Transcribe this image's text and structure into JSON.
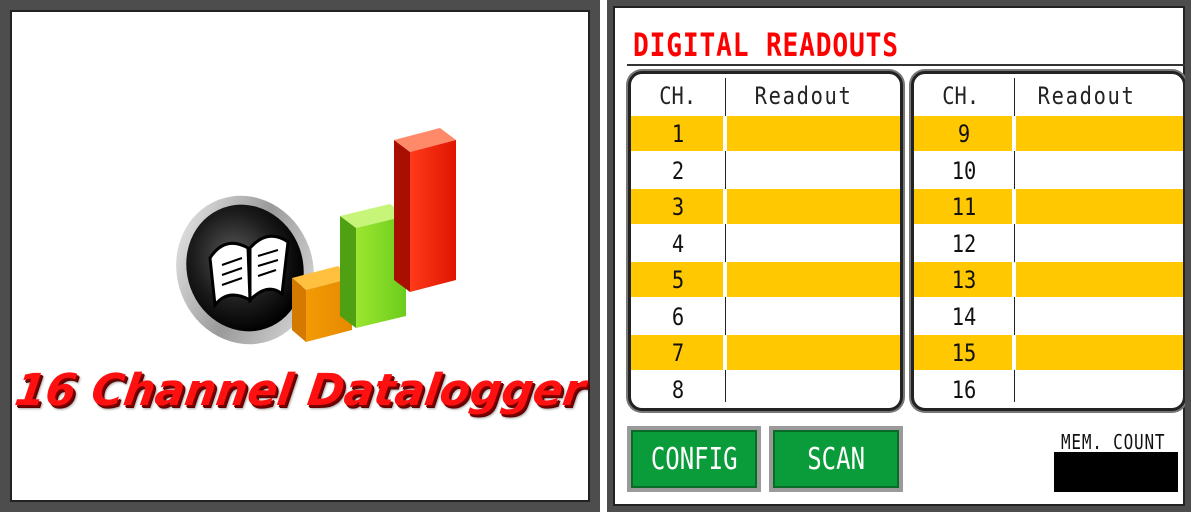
{
  "splash": {
    "title": "16 Channel Datalogger",
    "logo_icon": "datalogger-logo-icon",
    "book_icon": "open-book-icon",
    "bar_chart_icon": "bar-chart-icon",
    "title_color": "#ff1010"
  },
  "readouts": {
    "title": "DIGITAL READOUTS",
    "title_color": "#ff0000",
    "highlight_color": "#ffc800",
    "left_table": {
      "header_ch": "CH.",
      "header_readout": "Readout",
      "rows": [
        {
          "ch": "1",
          "readout": "",
          "highlight": true
        },
        {
          "ch": "2",
          "readout": "",
          "highlight": false
        },
        {
          "ch": "3",
          "readout": "",
          "highlight": true
        },
        {
          "ch": "4",
          "readout": "",
          "highlight": false
        },
        {
          "ch": "5",
          "readout": "",
          "highlight": true
        },
        {
          "ch": "6",
          "readout": "",
          "highlight": false
        },
        {
          "ch": "7",
          "readout": "",
          "highlight": true
        },
        {
          "ch": "8",
          "readout": "",
          "highlight": false
        }
      ]
    },
    "right_table": {
      "header_ch": "CH.",
      "header_readout": "Readout",
      "rows": [
        {
          "ch": "9",
          "readout": "",
          "highlight": true
        },
        {
          "ch": "10",
          "readout": "",
          "highlight": false
        },
        {
          "ch": "11",
          "readout": "",
          "highlight": true
        },
        {
          "ch": "12",
          "readout": "",
          "highlight": false
        },
        {
          "ch": "13",
          "readout": "",
          "highlight": true
        },
        {
          "ch": "14",
          "readout": "",
          "highlight": false
        },
        {
          "ch": "15",
          "readout": "",
          "highlight": true
        },
        {
          "ch": "16",
          "readout": "",
          "highlight": false
        }
      ]
    },
    "buttons": {
      "config_label": "CONFIG",
      "scan_label": "SCAN",
      "color": "#0a9b3a"
    },
    "mem_count": {
      "label": "MEM. COUNT",
      "value": ""
    }
  }
}
